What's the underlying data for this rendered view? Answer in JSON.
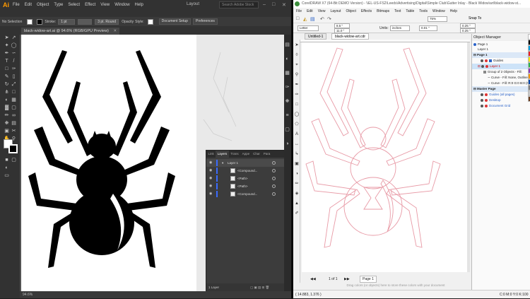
{
  "ai": {
    "logo": "Ai",
    "menu": [
      "File",
      "Edit",
      "Object",
      "Type",
      "Select",
      "Effect",
      "View",
      "Window",
      "Help"
    ],
    "workspace": "Layout",
    "search_placeholder": "Search Adobe Stock",
    "control": {
      "selection": "No Selection",
      "stroke_label": "Stroke:",
      "stroke_weight": "1 pt",
      "brush": "3 pt. Round",
      "opacity_label": "Opacity",
      "style_label": "Style:",
      "doc_setup": "Document Setup",
      "preferences": "Preferences"
    },
    "doc_tab": "black-widow-art.ai @ 94.6% (RGB/GPU Preview)",
    "status_zoom": "94.6%",
    "layers": {
      "tabs": [
        "Link",
        "Layers",
        "Trans",
        "Appe",
        "Char",
        "Para"
      ],
      "active_tab": "Layers",
      "rows": [
        "Layer 1",
        "<Compound...",
        "<Path>",
        "<Path>",
        "<Compound..."
      ],
      "footer": "1 Layer"
    },
    "colors": {
      "accent": "#ff9a00",
      "layer_bar": "#3a6bff"
    }
  },
  "cd": {
    "title": "CorelDRAW X7 (64-Bit DEMO Version) - \\\\EL-US-FS2\\Leeds\\Advertising\\Digital\\Simple Club\\Gutter Inlay - Black Widow\\art\\black-widow-st...",
    "menu": [
      "File",
      "Edit",
      "View",
      "Layout",
      "Object",
      "Effects",
      "Bitmaps",
      "Text",
      "Table",
      "Tools",
      "Window",
      "Help"
    ],
    "zoom": "75%",
    "snap": "Snap To",
    "paper": "Letter",
    "width": "8.5 \"",
    "height": "11.0 \"",
    "units_label": "Units:",
    "units": "inches",
    "nudge": "0.01 \"",
    "dup_x": "0.25 \"",
    "dup_y": "0.25 \"",
    "tabs": [
      "Untitled-1",
      "black-widow-art.cdr"
    ],
    "page_info": "1 of 1",
    "page_tab": "Page 1",
    "hint": "Drag colors (or objects) here to store these colors with your document",
    "coords": "( 14.883, 1.376 )",
    "color_info": "C:0 M:0 Y:0 K:100",
    "object_manager": {
      "title": "Object Manager",
      "rows": [
        "Page 1",
        "Layer 1",
        "Page 1",
        "Guides",
        "Layer 1",
        "Group of 2 Objects - Fill:",
        "Curve - Fill: None, Outline",
        "Curve - Fill: R:0 G:0 B:0 (#",
        "Master Page",
        "Guides (all pages)",
        "Desktop",
        "Document Grid"
      ]
    },
    "palette": [
      "#ffffff",
      "#000000",
      "#00a0e0",
      "#e8202a",
      "#f7e400",
      "#2bb24c",
      "#8a3ab9",
      "#f39200",
      "#0047ab",
      "#7f7f7f",
      "#c8c8c8",
      "#6b3e1e"
    ],
    "colors": {
      "outline": "#e89aa6"
    }
  }
}
